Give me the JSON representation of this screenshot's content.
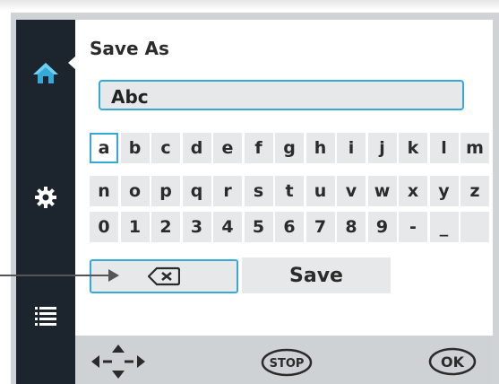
{
  "dialog": {
    "title": "Save As"
  },
  "filename": {
    "value": "Abc"
  },
  "keyboard": {
    "row1": [
      "a",
      "b",
      "c",
      "d",
      "e",
      "f",
      "g",
      "h",
      "i",
      "j",
      "k",
      "l",
      "m"
    ],
    "row2": [
      "n",
      "o",
      "p",
      "q",
      "r",
      "s",
      "t",
      "u",
      "v",
      "w",
      "x",
      "y",
      "z"
    ],
    "row3": [
      "0",
      "1",
      "2",
      "3",
      "4",
      "5",
      "6",
      "7",
      "8",
      "9",
      "-",
      "_",
      ""
    ],
    "selected_key": "a"
  },
  "actions": {
    "save_label": "Save"
  },
  "footer": {
    "stop_label": "STOP",
    "ok_label": "OK"
  },
  "icons": [
    "home-icon",
    "gear-icon",
    "list-icon",
    "backspace-icon",
    "directional-arrows-icon"
  ],
  "colors": {
    "accent": "#35a9d7",
    "sidebar": "#1c252e",
    "key_bg": "#e6e8ea",
    "footer_bg": "#cfd2d5"
  }
}
